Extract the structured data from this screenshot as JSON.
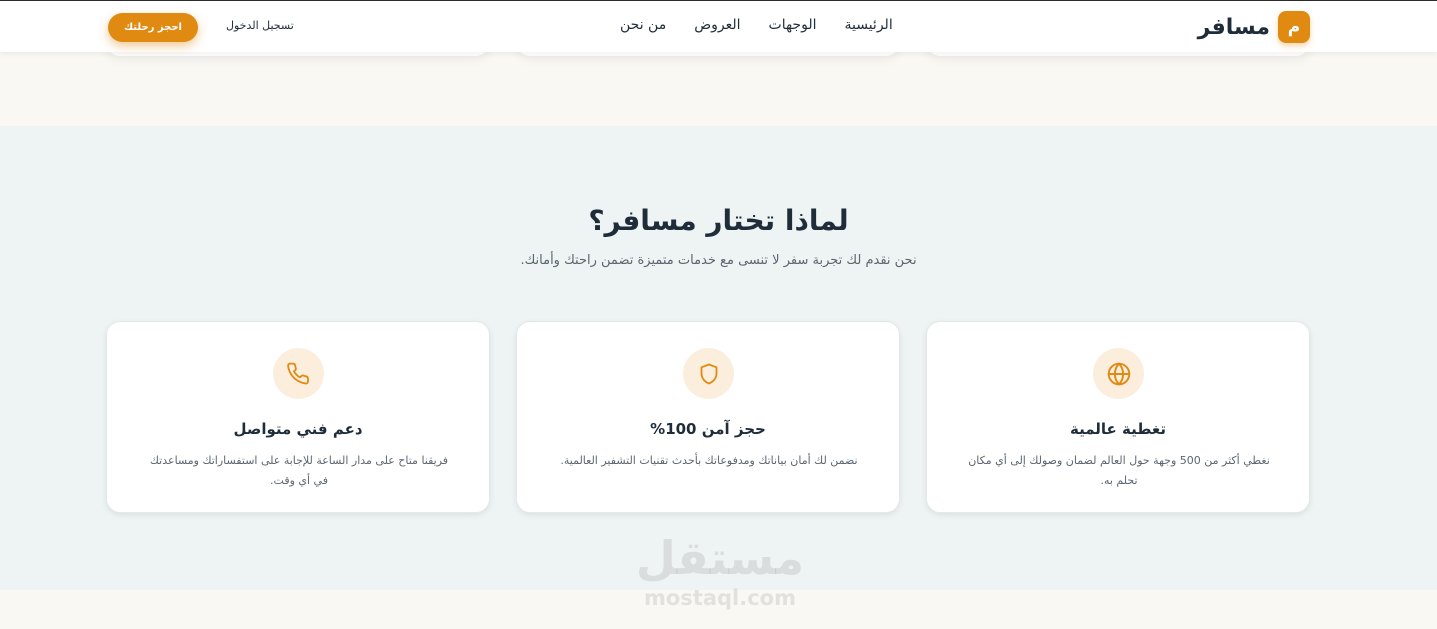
{
  "header": {
    "brand_mark": "م",
    "brand_name": "مسافر",
    "nav": [
      {
        "label": "الرئيسية"
      },
      {
        "label": "الوجهات"
      },
      {
        "label": "العروض"
      },
      {
        "label": "من نحن"
      }
    ],
    "login_label": "تسجيل الدخول",
    "cta_label": "احجز رحلتك"
  },
  "features": {
    "title": "لماذا تختار مسافر؟",
    "subtitle": "نحن نقدم لك تجربة سفر لا تنسى مع خدمات متميزة تضمن راحتك وأمانك.",
    "cards": [
      {
        "icon": "globe-icon",
        "title": "تغطية عالمية",
        "desc": "نغطي أكثر من 500 وجهة حول العالم لضمان وصولك إلى أي مكان تحلم به."
      },
      {
        "icon": "shield-icon",
        "title": "حجز آمن 100%",
        "desc": "نضمن لك أمان بياناتك ومدفوعاتك بأحدث تقنيات التشفير العالمية."
      },
      {
        "icon": "phone-icon",
        "title": "دعم فني متواصل",
        "desc": "فريقنا متاح على مدار الساعة للإجابة على استفساراتك ومساعدتك في أي وقت."
      }
    ]
  },
  "watermark": {
    "arabic": "مستقل",
    "latin": "mostaql.com"
  },
  "colors": {
    "accent": "#e08a12",
    "icon_bg": "#fbeedd",
    "section_bg": "#eef3f3",
    "page_bg": "#faf8f3"
  }
}
